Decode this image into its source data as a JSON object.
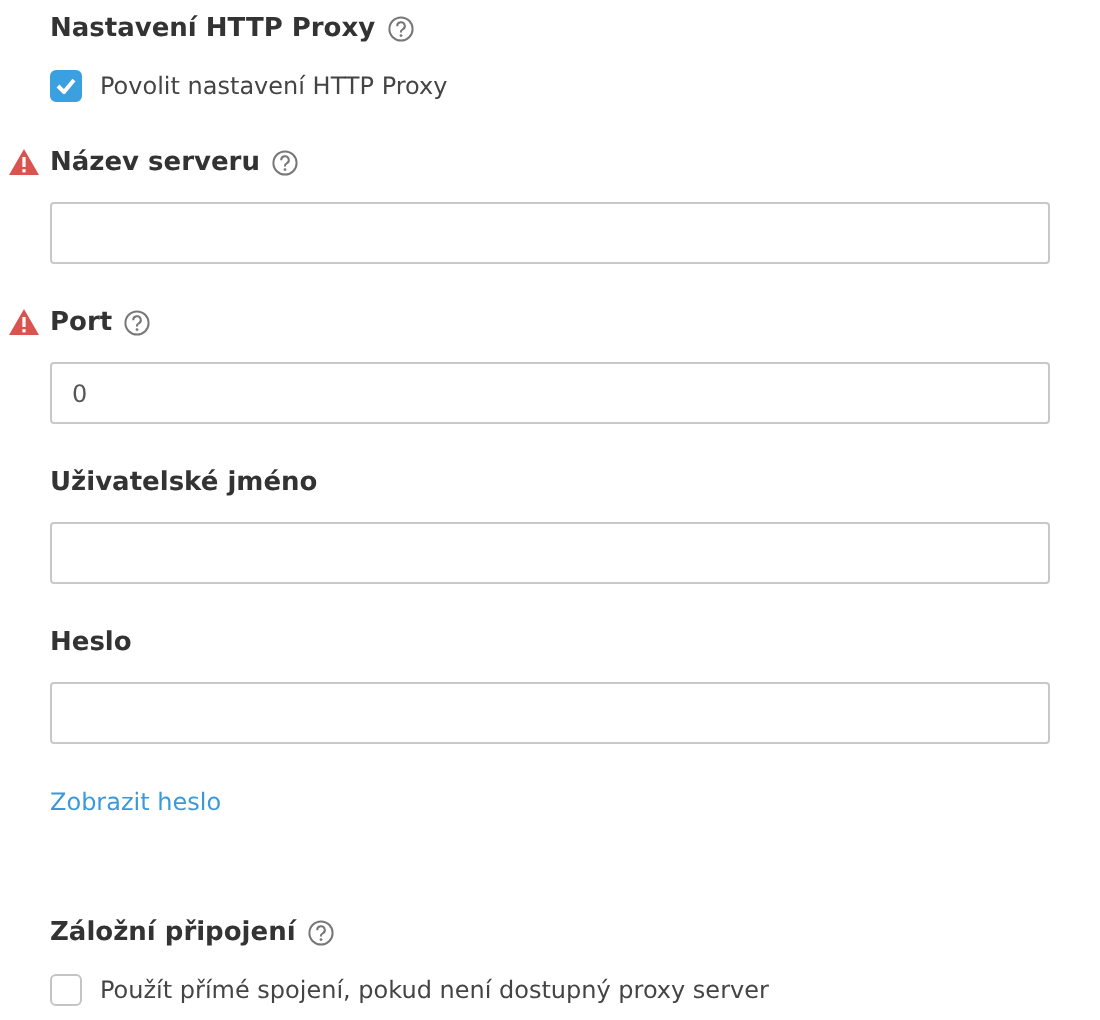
{
  "proxy_section": {
    "title": "Nastavení HTTP Proxy",
    "help": true,
    "checkbox": {
      "label": "Povolit nastavení HTTP Proxy",
      "checked": true
    }
  },
  "fields": [
    {
      "label": "Název serveru",
      "warning": true,
      "help": true
    },
    {
      "label": "Port",
      "warning": true,
      "help": true,
      "value": "0"
    },
    {
      "label": "Uživatelské jméno",
      "warning": false,
      "help": false
    },
    {
      "label": "Heslo",
      "warning": false,
      "help": false
    }
  ],
  "show_password_link": "Zobrazit heslo",
  "fallback_section": {
    "title": "Záložní připojení",
    "help": true,
    "checkbox": {
      "label": "Použít přímé spojení, pokud není dostupný proxy server",
      "checked": false
    }
  }
}
